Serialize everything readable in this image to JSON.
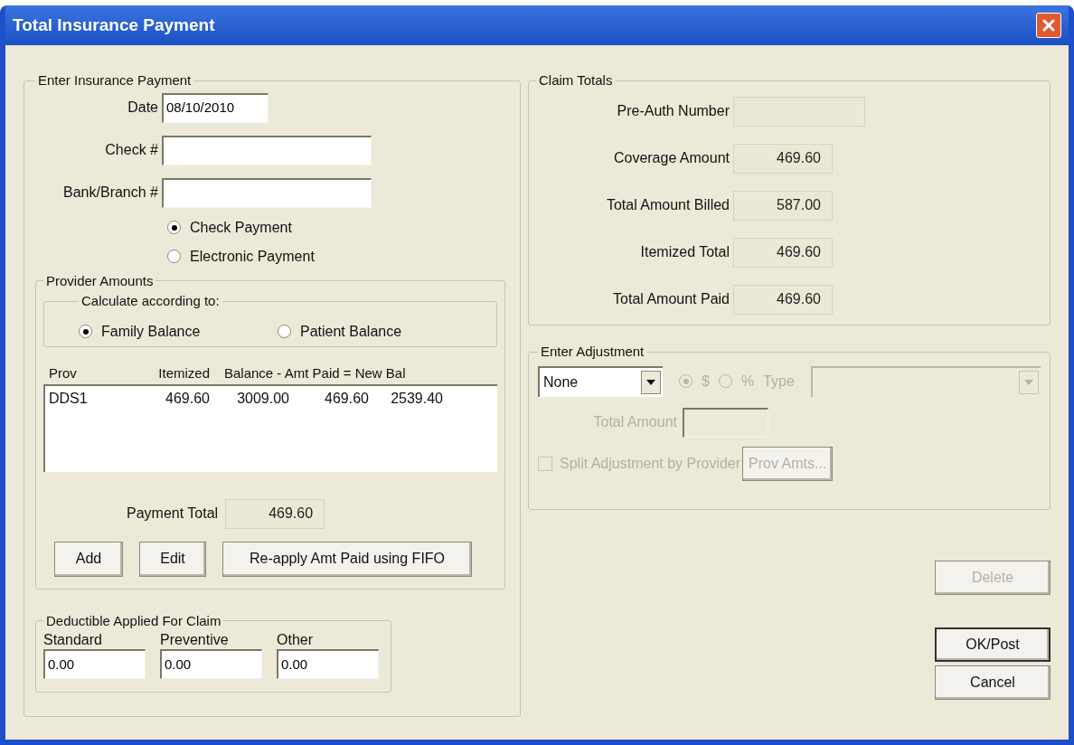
{
  "window": {
    "title": "Total Insurance Payment"
  },
  "payment": {
    "title": "Enter Insurance Payment",
    "fields": [
      {
        "label": "Date",
        "value": "08/10/2010"
      },
      {
        "label": "Check #"
      },
      {
        "label": "Bank/Branch #"
      }
    ],
    "radios": [
      {
        "label": "Check Payment",
        "selected": true
      },
      {
        "label": "Electronic Payment",
        "selected": false
      }
    ]
  },
  "provider_amounts": {
    "title": "Provider Amounts",
    "calculate": {
      "title": "Calculate according to:",
      "options": [
        {
          "label": "Family Balance",
          "selected": true
        },
        {
          "label": "Patient Balance",
          "selected": false
        }
      ]
    },
    "list": {
      "columns": [
        "Prov",
        "Itemized",
        "Balance - Amt Paid = New Bal"
      ],
      "rows": [
        [
          "DDS1",
          "469.60",
          "3009.00",
          "469.60",
          "2539.40"
        ]
      ]
    },
    "payment_total": {
      "label": "Payment Total",
      "value": "469.60"
    },
    "buttons": [
      "Add",
      "Edit",
      "Re-apply Amt Paid using FIFO"
    ]
  },
  "deductible": {
    "title": "Deductible Applied For Claim",
    "fields": [
      {
        "label": "Standard",
        "value": "0.00"
      },
      {
        "label": "Preventive",
        "value": "0.00"
      },
      {
        "label": "Other",
        "value": "0.00"
      }
    ]
  },
  "claim_totals": {
    "title": "Claim Totals",
    "fields": [
      {
        "label": "Pre-Auth Number"
      },
      {
        "label": "Coverage Amount",
        "value": "469.60"
      },
      {
        "label": "Total Amount Billed",
        "value": "587.00"
      },
      {
        "label": "Itemized Total",
        "value": "469.60"
      },
      {
        "label": "Total Amount Paid",
        "value": "469.60"
      }
    ]
  },
  "adjustment": {
    "title": "Enter Adjustment",
    "dropdown": {
      "value": "None"
    },
    "radios": [
      {
        "label": "$",
        "selected": true,
        "disabled": true
      },
      {
        "label": "%",
        "selected": false,
        "disabled": true
      }
    ],
    "type_label": "Type",
    "type_disabled": true,
    "total_amount": {
      "label": "Total Amount",
      "disabled": true
    },
    "split": {
      "label": "Split Adjustment by Provider",
      "checked": false,
      "disabled": true
    },
    "prov_amts": {
      "label": "Prov Amts...",
      "disabled": true
    }
  },
  "buttons": [
    {
      "label": "Delete",
      "disabled": true
    },
    {
      "label": "OK/Post",
      "disabled": false,
      "default": true
    },
    {
      "label": "Cancel",
      "disabled": false,
      "default": false
    }
  ]
}
